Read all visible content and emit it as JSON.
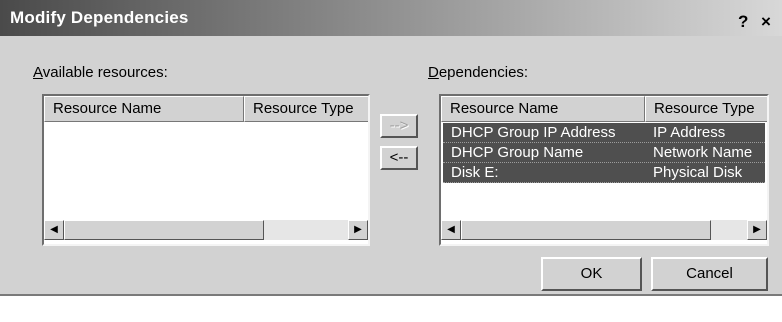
{
  "window": {
    "title": "Modify Dependencies",
    "help_label": "?",
    "close_label": "×"
  },
  "available": {
    "label_accel": "A",
    "label_rest": "vailable resources:",
    "columns": [
      "Resource Name",
      "Resource Type"
    ],
    "rows": []
  },
  "dependencies": {
    "label_accel": "D",
    "label_rest": "ependencies:",
    "columns": [
      "Resource Name",
      "Resource Type"
    ],
    "rows": [
      {
        "name": "DHCP Group IP Address",
        "type": "IP Address"
      },
      {
        "name": "DHCP Group Name",
        "type": "Network Name"
      },
      {
        "name": "Disk E:",
        "type": "Physical Disk"
      }
    ]
  },
  "buttons": {
    "add": "-->",
    "remove": "<--",
    "ok": "OK",
    "cancel": "Cancel"
  },
  "scroll": {
    "left_arrow": "◀",
    "right_arrow": "▶"
  }
}
